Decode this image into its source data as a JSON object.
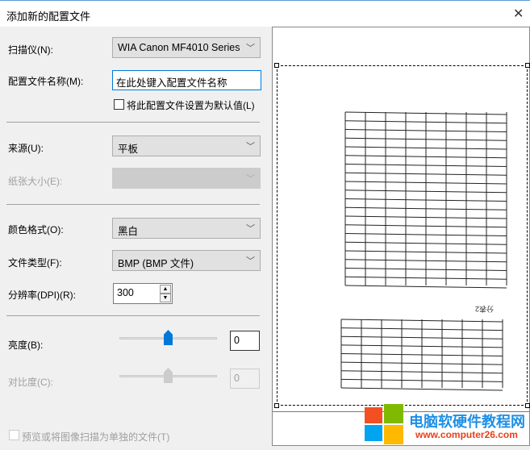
{
  "window": {
    "title": "添加新的配置文件",
    "close_icon": "close-icon"
  },
  "form": {
    "scanner": {
      "label": "扫描仪(N):",
      "value": "WIA Canon MF4010 Series"
    },
    "profile_name": {
      "label": "配置文件名称(M):",
      "value": "在此处键入配置文件名称"
    },
    "default_checkbox": {
      "label": "将此配置文件设置为默认值(L)",
      "checked": false
    },
    "source": {
      "label": "来源(U):",
      "value": "平板"
    },
    "paper_size": {
      "label": "纸张大小(E):",
      "value": "",
      "disabled": true
    },
    "color_format": {
      "label": "颜色格式(O):",
      "value": "黑白"
    },
    "file_type": {
      "label": "文件类型(F):",
      "value": "BMP (BMP 文件)"
    },
    "resolution": {
      "label": "分辨率(DPI)(R):",
      "value": "300"
    },
    "brightness": {
      "label": "亮度(B):",
      "value": "0",
      "slider_fraction": 0.5
    },
    "contrast": {
      "label": "对比度(C):",
      "value": "0",
      "slider_fraction": 0.5,
      "disabled": true
    },
    "separate_files_checkbox": {
      "label": "预览或将图像扫描为单独的文件(T)",
      "checked": false,
      "disabled": true
    }
  },
  "watermark": {
    "title": "电脑软硬件教程网",
    "url": "www.computer26.com"
  },
  "colors": {
    "accent": "#0078d7",
    "watermark_blue": "#1e90e6",
    "watermark_red": "#e8401c"
  }
}
